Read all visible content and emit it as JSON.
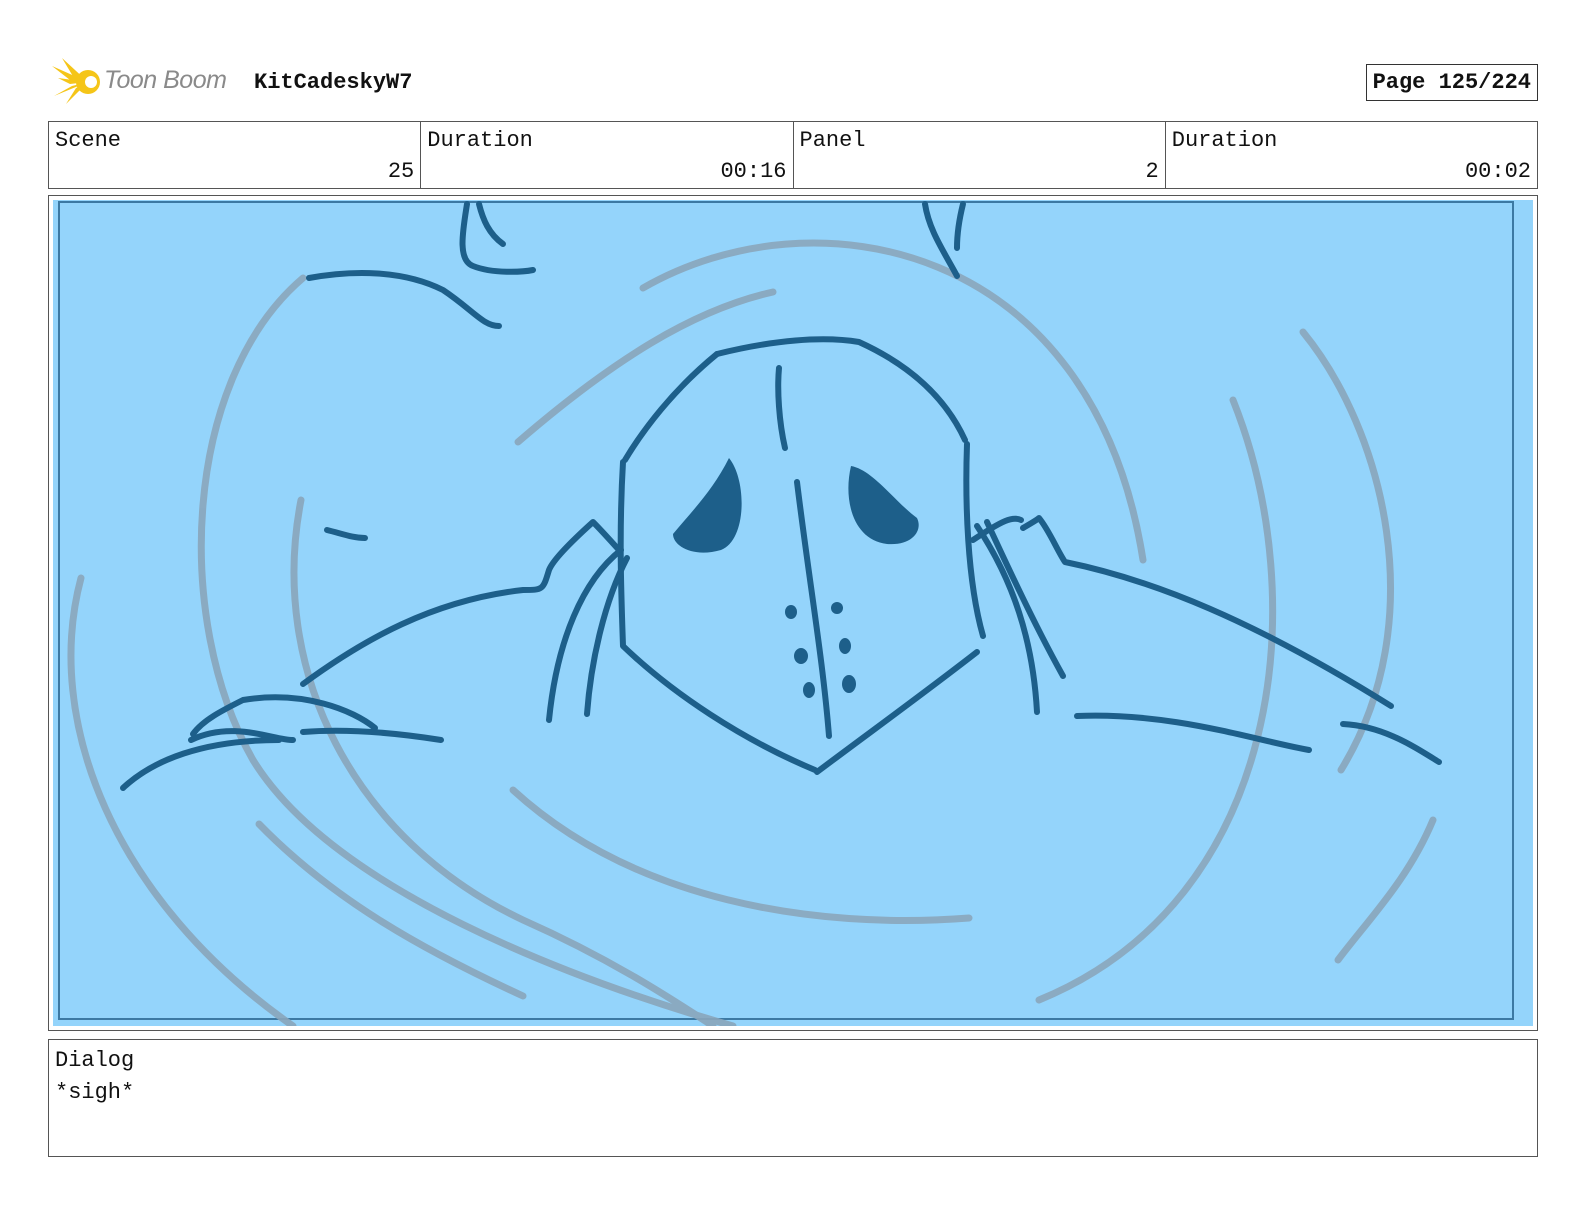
{
  "header": {
    "logo_text": "Toon Boom",
    "project_title": "KitCadeskyW7",
    "page_label": "Page 125/224"
  },
  "info": {
    "scene_label": "Scene",
    "scene_value": "25",
    "scene_duration_label": "Duration",
    "scene_duration_value": "00:16",
    "panel_label": "Panel",
    "panel_value": "2",
    "panel_duration_label": "Duration",
    "panel_duration_value": "00:02"
  },
  "dialog": {
    "label": "Dialog",
    "text": "*sigh*"
  },
  "colors": {
    "panel_background": "#94d4fb",
    "sketch_dark": "#1d5f8a",
    "sketch_light": "#8aa6bb",
    "logo_yellow": "#f5c518"
  },
  "icons": {
    "logo": "toon-boom-starburst-icon"
  }
}
